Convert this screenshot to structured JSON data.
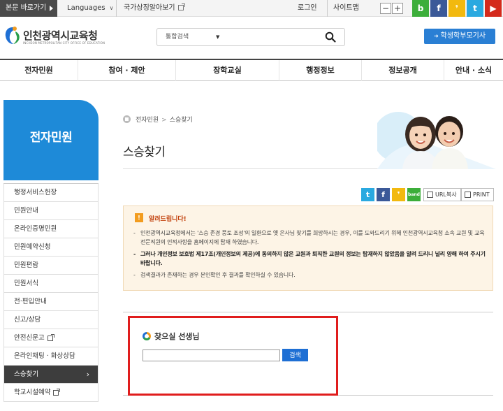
{
  "topbar": {
    "skip_label": "본문 바로가기",
    "languages_label": "Languages",
    "symbol_label": "국가상징알아보기",
    "login_label": "로그인",
    "sitemap_label": "사이트맵",
    "zoom_out": "−",
    "zoom_in": "+",
    "social": [
      {
        "name": "blog-icon",
        "glyph": "b",
        "color": "#3cae3a"
      },
      {
        "name": "facebook-icon",
        "glyph": "f",
        "color": "#3b5998"
      },
      {
        "name": "kakaostory-icon",
        "glyph": "❜",
        "color": "#f2b90f"
      },
      {
        "name": "twitter-icon",
        "glyph": "t",
        "color": "#2aa9e0"
      },
      {
        "name": "youtube-icon",
        "glyph": "▶",
        "color": "#d42a1c"
      }
    ]
  },
  "header": {
    "logo_ko": "인천광역시교육청",
    "logo_en": "INCHEON METROPOLITAN CITY OFFICE OF EDUCATION",
    "search_select": "통합검색",
    "parent_button": "학생학부모기사"
  },
  "gnb": [
    "전자민원",
    "참여 · 제안",
    "장학교실",
    "행정정보",
    "정보공개",
    "안내 · 소식"
  ],
  "lnb": {
    "title": "전자민원",
    "items": [
      {
        "label": "행정서비스헌장",
        "ext": false,
        "active": false
      },
      {
        "label": "민원안내",
        "ext": false,
        "active": false
      },
      {
        "label": "온라인증명민원",
        "ext": false,
        "active": false
      },
      {
        "label": "민원예약신청",
        "ext": false,
        "active": false
      },
      {
        "label": "민원편람",
        "ext": false,
        "active": false
      },
      {
        "label": "민원서식",
        "ext": false,
        "active": false
      },
      {
        "label": "전·편입안내",
        "ext": false,
        "active": false
      },
      {
        "label": "신고/상담",
        "ext": false,
        "active": false
      },
      {
        "label": "안전신문고",
        "ext": true,
        "active": false
      },
      {
        "label": "온라인채팅 · 화상상담",
        "ext": false,
        "active": false
      },
      {
        "label": "스승찾기",
        "ext": false,
        "active": true
      },
      {
        "label": "학교시설예약",
        "ext": true,
        "active": false
      }
    ]
  },
  "content": {
    "breadcrumb": [
      "전자민원",
      "스승찾기"
    ],
    "title": "스승찾기",
    "share": {
      "twitter": "t",
      "facebook": "f",
      "kakao": "❜",
      "band": "band",
      "url_copy": "URL복사",
      "print": "PRINT"
    },
    "notice": {
      "icon": "!",
      "title": "알려드립니다!",
      "items": [
        {
          "text": "인천광역시교육청에서는 '스승 존경 풍토 조성'의 일환으로 옛 은사님 찾기를 희망하시는 경우, 이를 도와드리기 위해 인천광역시교육청 소속 교원 및 교육전문직원의 인적사항을 홈페이지에 탑재 하였습니다.",
          "bold": false
        },
        {
          "text": "그러나 개인정보 보호법 제17조(개인정보의 제공)에 동의하지 않은 교원과 퇴직한 교원의 정보는 탑재하지 않았음을 알려 드리니 널리 양해 하여 주시기 바랍니다.",
          "bold": true
        },
        {
          "text": "검색결과가 존재하는 경우 본인확인 후 결과를 확인하실 수 있습니다.",
          "bold": false
        }
      ]
    },
    "find": {
      "label": "찾으실 선생님",
      "input_value": "",
      "button": "검색"
    }
  }
}
